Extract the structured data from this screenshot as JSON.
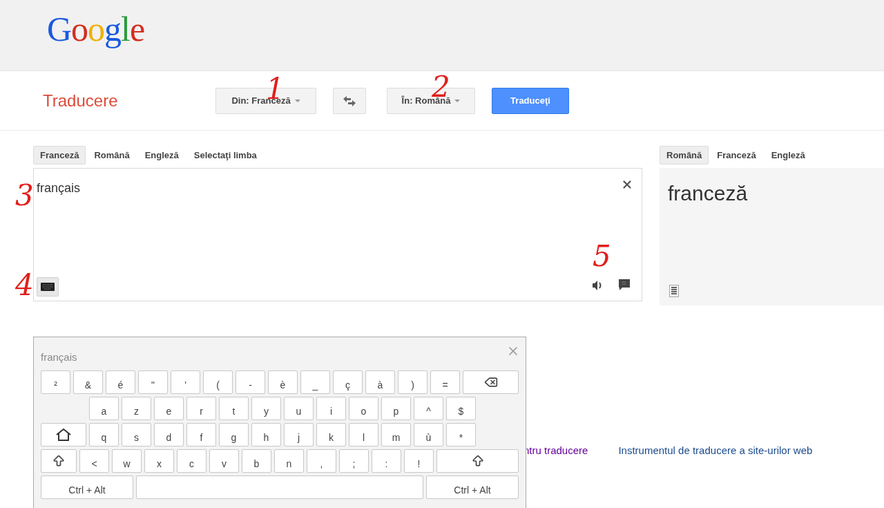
{
  "header": {
    "logo": "Google"
  },
  "toolbar": {
    "title": "Traducere",
    "from": "Din: Franceză",
    "to": "În: Română",
    "translate": "Traduceţi"
  },
  "source_tabs": [
    {
      "label": "Franceză",
      "selected": true
    },
    {
      "label": "Română",
      "selected": false
    },
    {
      "label": "Engleză",
      "selected": false
    },
    {
      "label": "Selectaţi limba",
      "selected": false
    }
  ],
  "target_tabs": [
    {
      "label": "Română",
      "selected": true
    },
    {
      "label": "Franceză",
      "selected": false
    },
    {
      "label": "Engleză",
      "selected": false
    }
  ],
  "source": {
    "value": "français"
  },
  "result": {
    "text": "franceză"
  },
  "links": [
    {
      "label": "ntru traducere",
      "visited": true
    },
    {
      "label": "Instrumentul de traducere a site-urilor web",
      "visited": false
    }
  ],
  "keyboard": {
    "title": "français",
    "rows": [
      {
        "keys": [
          {
            "kind": "char",
            "label": "²"
          },
          {
            "kind": "char",
            "label": "&"
          },
          {
            "kind": "char",
            "label": "é"
          },
          {
            "kind": "char",
            "label": "\""
          },
          {
            "kind": "char",
            "label": "'"
          },
          {
            "kind": "char",
            "label": "("
          },
          {
            "kind": "char",
            "label": "-"
          },
          {
            "kind": "char",
            "label": "è"
          },
          {
            "kind": "char",
            "label": "_"
          },
          {
            "kind": "char",
            "label": "ç"
          },
          {
            "kind": "char",
            "label": "à"
          },
          {
            "kind": "char",
            "label": ")"
          },
          {
            "kind": "char",
            "label": "="
          },
          {
            "kind": "backspace"
          }
        ]
      },
      {
        "keys": [
          {
            "kind": "indent"
          },
          {
            "kind": "char",
            "label": "a"
          },
          {
            "kind": "char",
            "label": "z"
          },
          {
            "kind": "char",
            "label": "e"
          },
          {
            "kind": "char",
            "label": "r"
          },
          {
            "kind": "char",
            "label": "t"
          },
          {
            "kind": "char",
            "label": "y"
          },
          {
            "kind": "char",
            "label": "u"
          },
          {
            "kind": "char",
            "label": "i"
          },
          {
            "kind": "char",
            "label": "o"
          },
          {
            "kind": "char",
            "label": "p"
          },
          {
            "kind": "char",
            "label": "^"
          },
          {
            "kind": "char",
            "label": "$"
          }
        ]
      },
      {
        "keys": [
          {
            "kind": "caps"
          },
          {
            "kind": "char",
            "label": "q"
          },
          {
            "kind": "char",
            "label": "s"
          },
          {
            "kind": "char",
            "label": "d"
          },
          {
            "kind": "char",
            "label": "f"
          },
          {
            "kind": "char",
            "label": "g"
          },
          {
            "kind": "char",
            "label": "h"
          },
          {
            "kind": "char",
            "label": "j"
          },
          {
            "kind": "char",
            "label": "k"
          },
          {
            "kind": "char",
            "label": "l"
          },
          {
            "kind": "char",
            "label": "m"
          },
          {
            "kind": "char",
            "label": "ù"
          },
          {
            "kind": "char",
            "label": "*"
          }
        ]
      },
      {
        "keys": [
          {
            "kind": "shift"
          },
          {
            "kind": "char",
            "label": "<"
          },
          {
            "kind": "char",
            "label": "w"
          },
          {
            "kind": "char",
            "label": "x"
          },
          {
            "kind": "char",
            "label": "c"
          },
          {
            "kind": "char",
            "label": "v"
          },
          {
            "kind": "char",
            "label": "b"
          },
          {
            "kind": "char",
            "label": "n"
          },
          {
            "kind": "char",
            "label": ","
          },
          {
            "kind": "char",
            "label": ";"
          },
          {
            "kind": "char",
            "label": ":"
          },
          {
            "kind": "char",
            "label": "!"
          },
          {
            "kind": "shift_wide"
          }
        ]
      },
      {
        "keys": [
          {
            "kind": "ctrl",
            "label": "Ctrl + Alt"
          },
          {
            "kind": "space"
          },
          {
            "kind": "ctrl",
            "label": "Ctrl + Alt"
          }
        ]
      }
    ]
  },
  "annotations": [
    "1",
    "2",
    "3",
    "4",
    "5"
  ]
}
